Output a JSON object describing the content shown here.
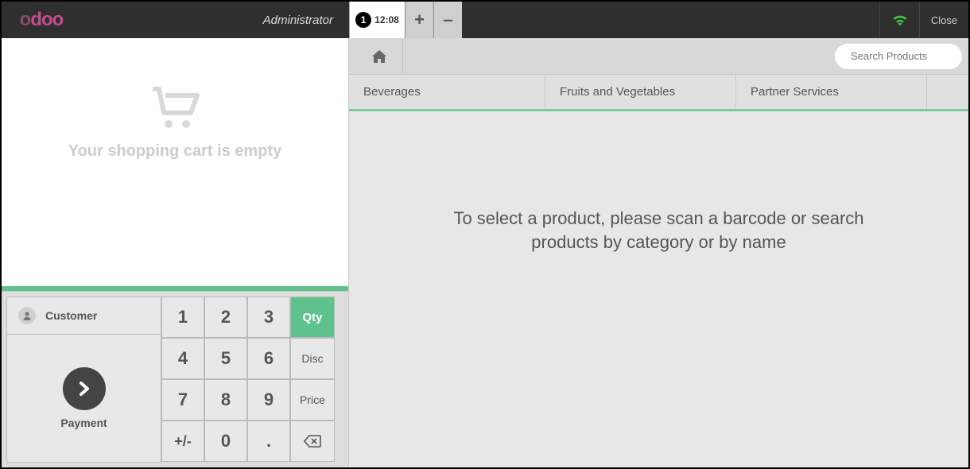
{
  "header": {
    "admin_label": "Administrator",
    "order_number": "1",
    "order_time": "12:08",
    "plus": "+",
    "minus": "–",
    "close_label": "Close"
  },
  "cart": {
    "empty_text": "Your shopping cart is empty"
  },
  "actionpad": {
    "customer_label": "Customer",
    "payment_label": "Payment"
  },
  "numpad": {
    "k1": "1",
    "k2": "2",
    "k3": "3",
    "k4": "4",
    "k5": "5",
    "k6": "6",
    "k7": "7",
    "k8": "8",
    "k9": "9",
    "sign": "+/-",
    "k0": "0",
    "dot": ".",
    "qty": "Qty",
    "disc": "Disc",
    "price": "Price"
  },
  "search": {
    "placeholder": "Search Products"
  },
  "categories": [
    "Beverages",
    "Fruits and Vegetables",
    "Partner Services"
  ],
  "products": {
    "hint": "To select a product, please scan a barcode or search products by category or by name"
  }
}
